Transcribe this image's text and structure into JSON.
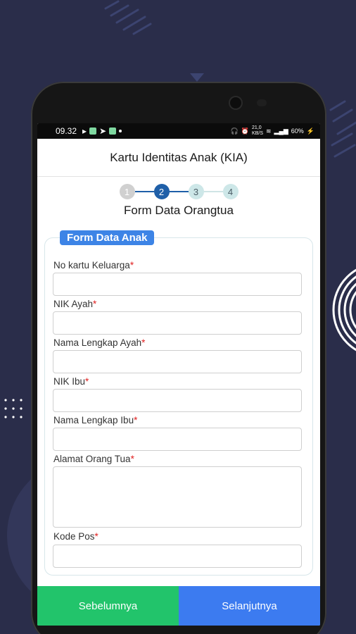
{
  "status_bar": {
    "time": "09.32",
    "net_speed_top": "21,0",
    "net_speed_bottom": "KB/S",
    "battery": "60%"
  },
  "app": {
    "title": "Kartu Identitas Anak (KIA)"
  },
  "stepper": {
    "steps": [
      "1",
      "2",
      "3",
      "4"
    ],
    "current_step": 2
  },
  "form": {
    "title": "Form Data Orangtua",
    "section_legend": "Form Data Anak",
    "required_marker": "*",
    "fields": [
      {
        "label": "No kartu Keluarga",
        "value": ""
      },
      {
        "label": "NIK Ayah",
        "value": ""
      },
      {
        "label": "Nama Lengkap Ayah",
        "value": ""
      },
      {
        "label": "NIK Ibu",
        "value": ""
      },
      {
        "label": "Nama Lengkap Ibu",
        "value": ""
      },
      {
        "label": "Alamat Orang Tua",
        "value": ""
      },
      {
        "label": "Kode Pos",
        "value": ""
      }
    ]
  },
  "buttons": {
    "prev": "Sebelumnya",
    "next": "Selanjutnya"
  },
  "colors": {
    "prev": "#22c46b",
    "next": "#3c7bf0",
    "active_step": "#1f5fa8",
    "legend": "#3d84e6"
  }
}
